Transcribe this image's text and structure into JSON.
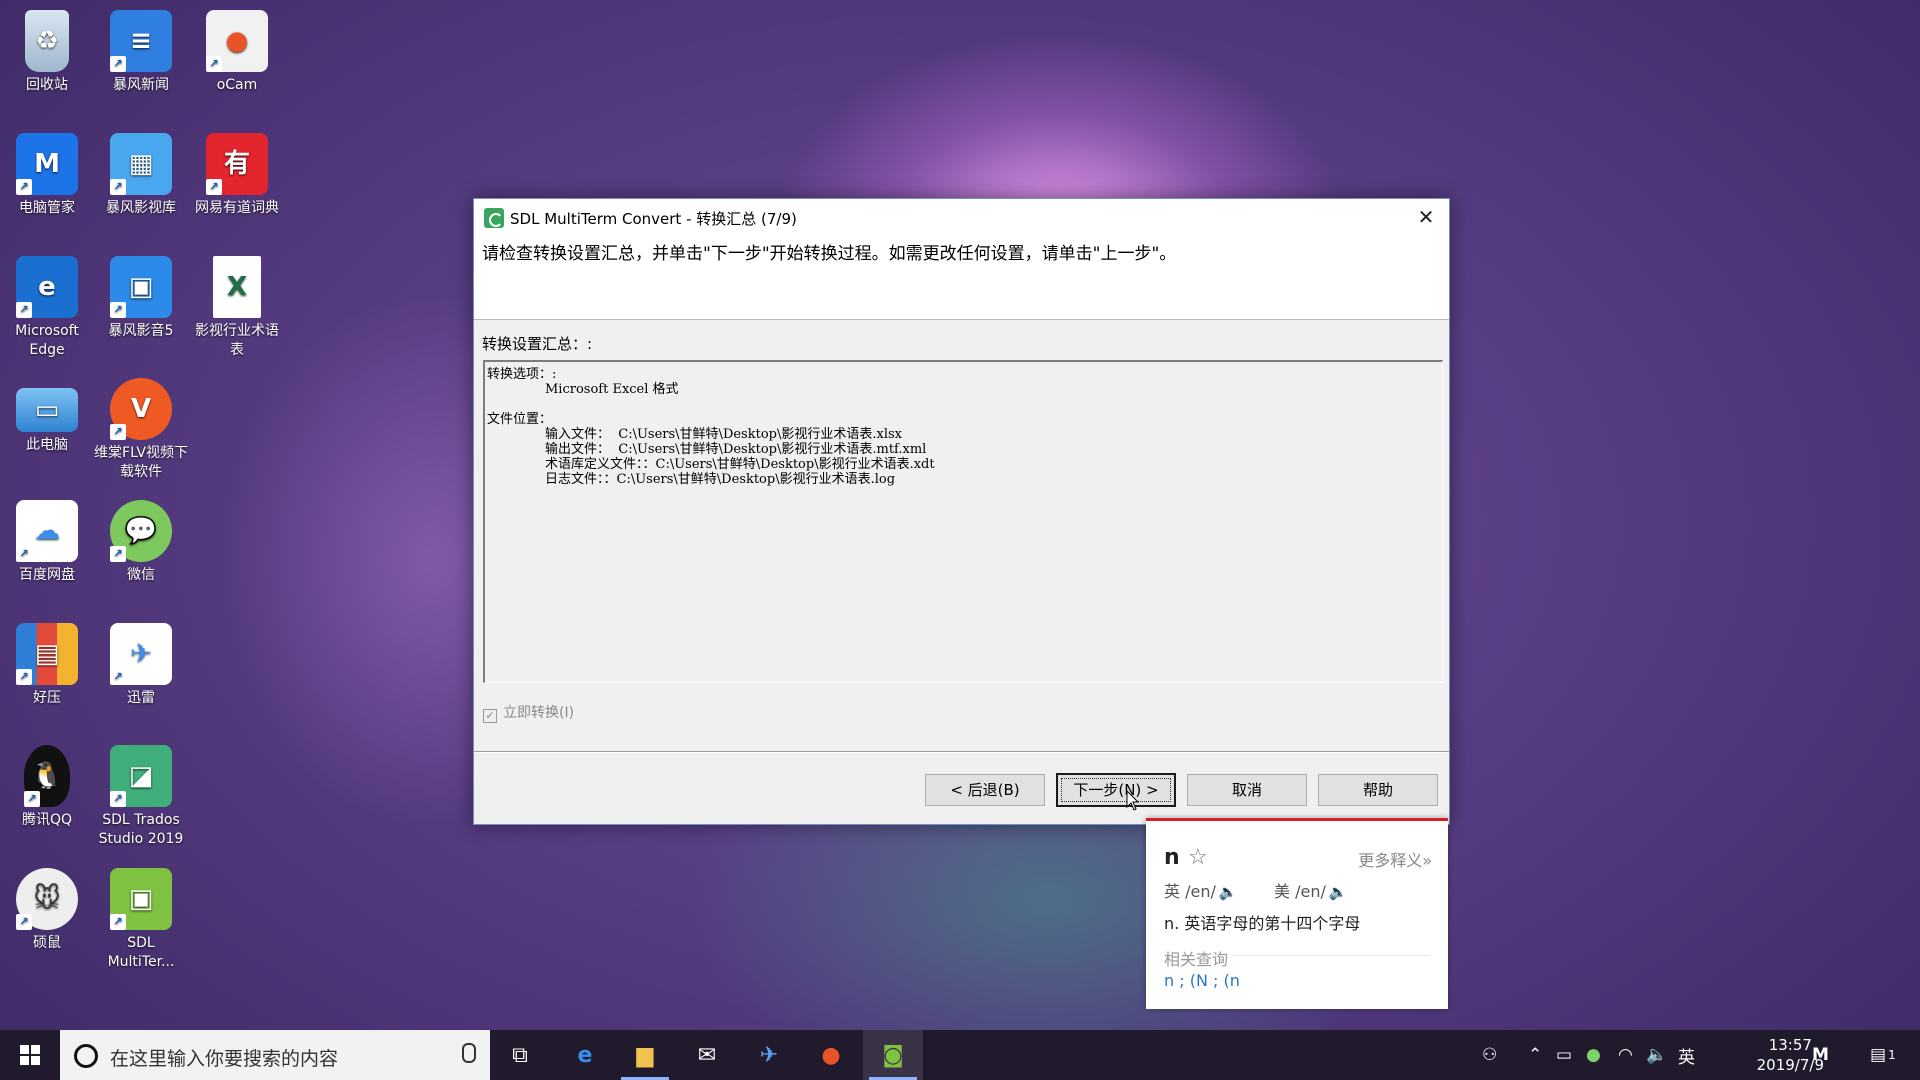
{
  "desktop": {
    "icons": [
      {
        "label": "回收站"
      },
      {
        "label": "暴风新闻"
      },
      {
        "label": "oCam"
      },
      {
        "label": "电脑管家"
      },
      {
        "label": "暴风影视库"
      },
      {
        "label": "网易有道词典"
      },
      {
        "label": "Microsoft Edge"
      },
      {
        "label": "暴风影音5"
      },
      {
        "label": "影视行业术语表"
      },
      {
        "label": "此电脑"
      },
      {
        "label": "维棠FLV视频下载软件"
      },
      {
        "label": "百度网盘"
      },
      {
        "label": "微信"
      },
      {
        "label": "好压"
      },
      {
        "label": "迅雷"
      },
      {
        "label": "腾讯QQ"
      },
      {
        "label": "SDL Trados Studio 2019"
      },
      {
        "label": "硕鼠"
      },
      {
        "label": "SDL MultiTer..."
      }
    ]
  },
  "dialog": {
    "title": "SDL MultiTerm Convert - 转换汇总 (7/9)",
    "instruction": "请检查转换设置汇总，并单击\"下一步\"开始转换过程。如需更改任何设置，请单击\"上一步\"。",
    "summary_label": "转换设置汇总：:",
    "summary": {
      "options_label": "转换选项：:",
      "format": "Microsoft Excel 格式",
      "location_label": "文件位置：",
      "input": "输入文件：  C:\\Users\\甘鲜特\\Desktop\\影视行业术语表.xlsx",
      "output": "输出文件：  C:\\Users\\甘鲜特\\Desktop\\影视行业术语表.mtf.xml",
      "termdef": "术语库定义文件：：C:\\Users\\甘鲜特\\Desktop\\影视行业术语表.xdt",
      "log": "日志文件：：C:\\Users\\甘鲜特\\Desktop\\影视行业术语表.log"
    },
    "checkbox_label": "立即转换(I)",
    "buttons": {
      "back": "< 后退(B)",
      "next": "下一步(N) >",
      "cancel": "取消",
      "help": "帮助"
    }
  },
  "dictionary": {
    "word": "n",
    "more": "更多释义»",
    "uk": "英 /en/",
    "us": "美 /en/",
    "definition": "n. 英语字母的第十四个字母",
    "related_title": "相关查询",
    "related": "n ; (N ; (n"
  },
  "taskbar": {
    "search_placeholder": "在这里输入你要搜索的内容",
    "ime": "英",
    "time": "13:57",
    "date": "2019/7/9",
    "notification_count": "1"
  },
  "colors": {
    "accent_red": "#d81e2a",
    "link_blue": "#2a77c9",
    "taskbar": "#201a2c"
  }
}
